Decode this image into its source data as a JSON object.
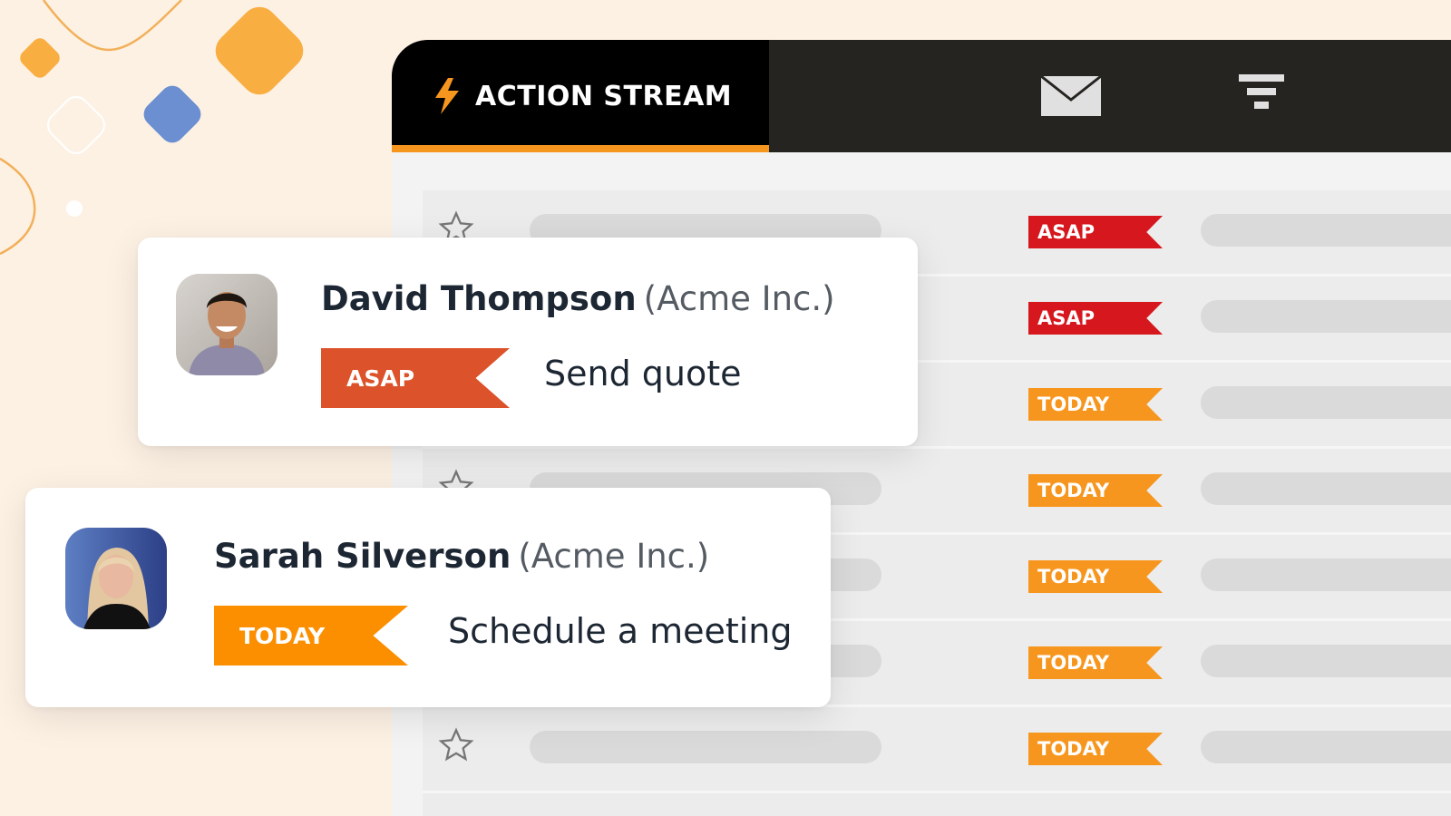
{
  "colors": {
    "background": "#fdf1e4",
    "topbar": "#262421",
    "accent": "#f7961e",
    "asap": "#d6181e",
    "today": "#f7961e",
    "card_asap": "#dc522a",
    "card_today": "#fb8f00"
  },
  "header": {
    "tab_title": "ACTION STREAM",
    "tab_icon": "bolt-icon",
    "mail_icon": "envelope-icon",
    "filter_icon": "funnel-icon"
  },
  "rows": [
    {
      "starred": false,
      "priority": "ASAP"
    },
    {
      "starred": false,
      "priority": "ASAP"
    },
    {
      "starred": false,
      "priority": "TODAY"
    },
    {
      "starred": false,
      "priority": "TODAY"
    },
    {
      "starred": false,
      "priority": "TODAY"
    },
    {
      "starred": false,
      "priority": "TODAY"
    },
    {
      "starred": false,
      "priority": "TODAY"
    }
  ],
  "cards": [
    {
      "name": "David Thompson",
      "company": "(Acme Inc.)",
      "priority": "ASAP",
      "task": "Send quote"
    },
    {
      "name": "Sarah Silverson",
      "company": "(Acme Inc.)",
      "priority": "TODAY",
      "task": "Schedule a meeting"
    }
  ]
}
